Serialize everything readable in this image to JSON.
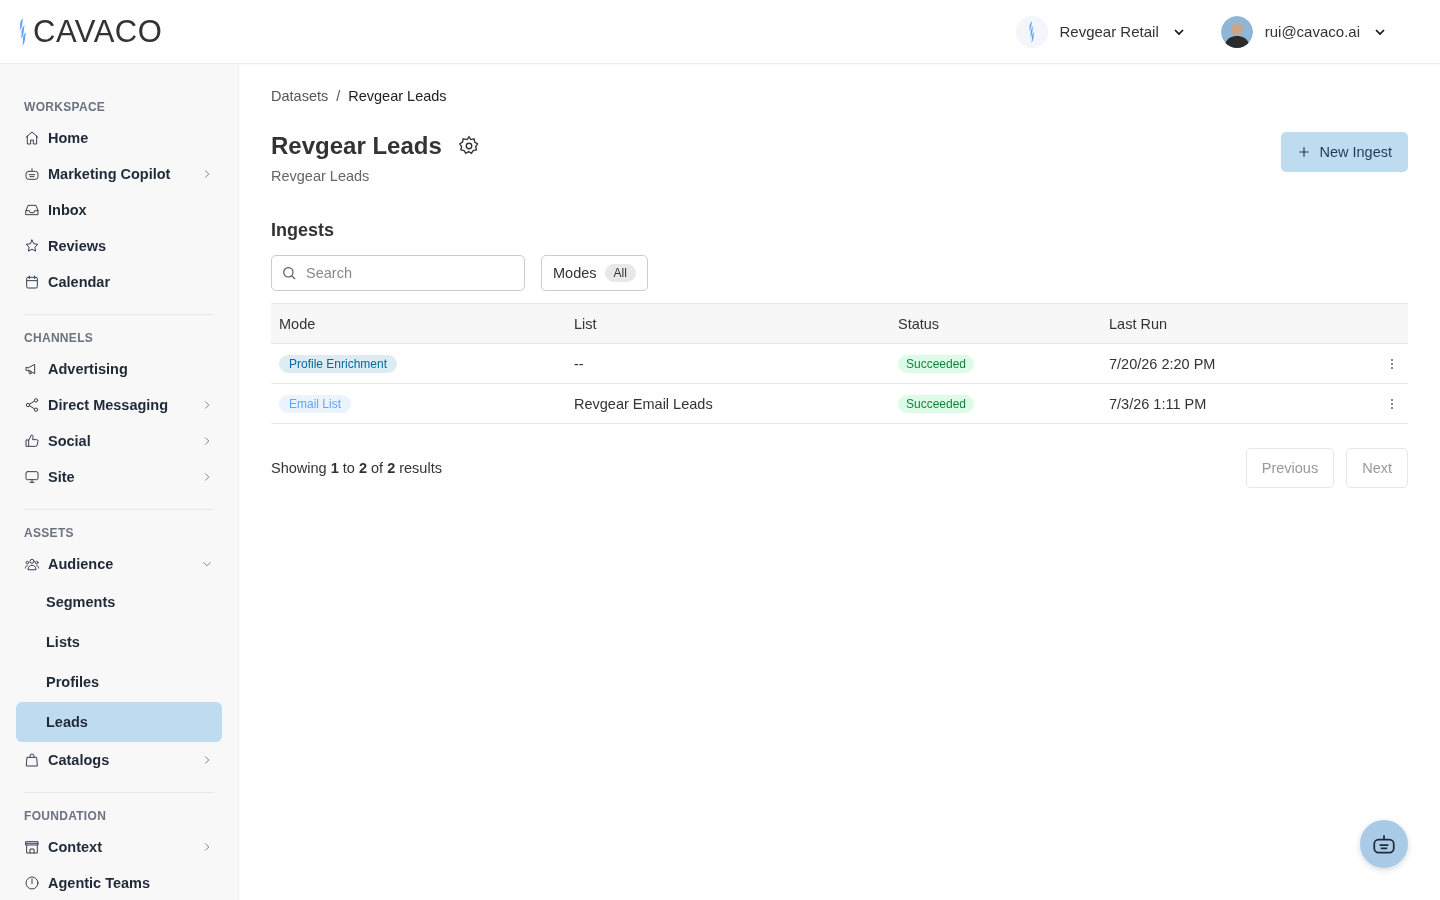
{
  "header": {
    "logo": "CAVACO",
    "workspace": "Revgear Retail",
    "user": "rui@cavaco.ai"
  },
  "sidebar": {
    "sections": [
      {
        "title": "WORKSPACE",
        "items": [
          {
            "label": "Home",
            "submenu": false
          },
          {
            "label": "Marketing Copilot",
            "submenu": true,
            "expanded": false
          },
          {
            "label": "Inbox",
            "submenu": false
          },
          {
            "label": "Reviews",
            "submenu": false
          },
          {
            "label": "Calendar",
            "submenu": false
          }
        ]
      },
      {
        "title": "CHANNELS",
        "items": [
          {
            "label": "Advertising",
            "submenu": false
          },
          {
            "label": "Direct Messaging",
            "submenu": true,
            "expanded": false
          },
          {
            "label": "Social",
            "submenu": true,
            "expanded": false
          },
          {
            "label": "Site",
            "submenu": true,
            "expanded": false
          }
        ]
      },
      {
        "title": "ASSETS",
        "items": [
          {
            "label": "Audience",
            "submenu": true,
            "expanded": true,
            "children": [
              {
                "label": "Segments",
                "selected": false
              },
              {
                "label": "Lists",
                "selected": false
              },
              {
                "label": "Profiles",
                "selected": false
              },
              {
                "label": "Leads",
                "selected": true
              }
            ]
          },
          {
            "label": "Catalogs",
            "submenu": true,
            "expanded": false
          }
        ]
      },
      {
        "title": "FOUNDATION",
        "items": [
          {
            "label": "Context",
            "submenu": true,
            "expanded": false
          },
          {
            "label": "Agentic Teams",
            "submenu": false
          }
        ]
      }
    ]
  },
  "breadcrumb": [
    "Datasets",
    "Revgear Leads"
  ],
  "breadcrumb_separator": "/",
  "title": "Revgear Leads",
  "subtitle": "Revgear Leads",
  "new_button": "New Ingest",
  "section_title": "Ingests",
  "search": {
    "placeholder": "Search"
  },
  "modes_filter": {
    "label": "Modes",
    "value": "All"
  },
  "table": {
    "columns": [
      "Mode",
      "List",
      "Status",
      "Last Run"
    ],
    "rows": [
      {
        "mode": "Profile Enrichment",
        "color": "#0369a1",
        "list": "--",
        "status": "Succeeded",
        "last_run": "7/20/26 2:20 PM"
      },
      {
        "mode": "Email List",
        "color": "#60a5fa",
        "list": "Revgear Email Leads",
        "status": "Succeeded",
        "last_run": "7/3/26 1:11 PM"
      }
    ]
  },
  "results": "Showing **1** to **2** of **2** results",
  "pagination": [
    "Previous",
    "Next"
  ]
}
